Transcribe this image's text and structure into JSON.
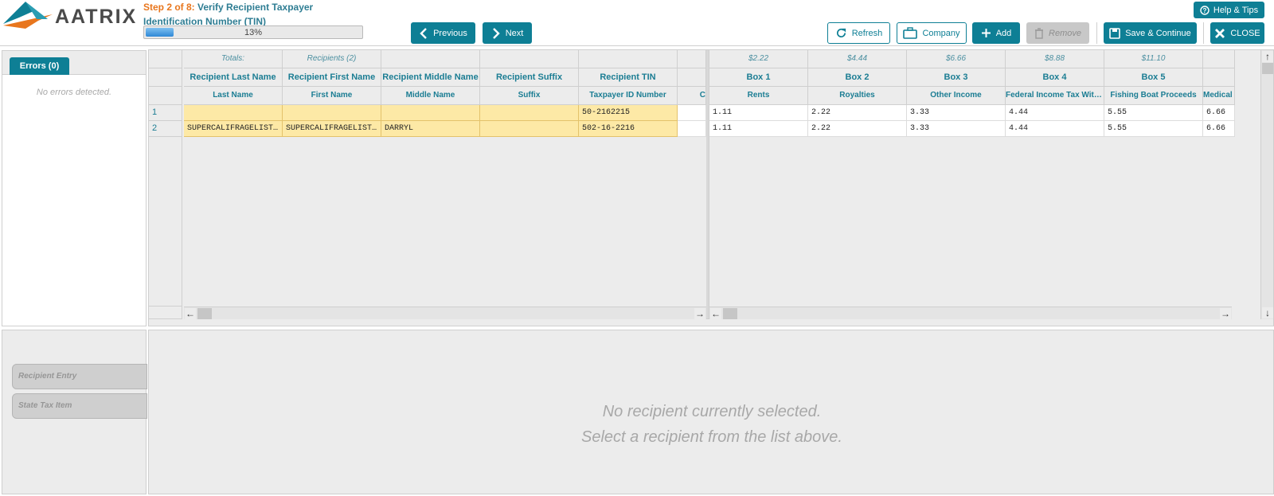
{
  "brand": {
    "name": "AATRIX"
  },
  "step": {
    "prefix": "Step 2 of 8:",
    "title": "Verify Recipient Taxpayer Identification Number (TIN)"
  },
  "progress": {
    "percent": 13,
    "label": "13%"
  },
  "nav": {
    "previous": "Previous",
    "next": "Next"
  },
  "toolbar": {
    "refresh": "Refresh",
    "company": "Company",
    "add": "Add",
    "remove": "Remove",
    "save": "Save & Continue",
    "close": "CLOSE"
  },
  "help": "Help & Tips",
  "errors": {
    "tab": "Errors (0)",
    "empty": "No errors detected."
  },
  "left_grid": {
    "totals": [
      "Totals:",
      "Recipients (2)",
      "",
      "",
      ""
    ],
    "headers": [
      "Recipient Last Name",
      "Recipient First Name",
      "Recipient Middle Name",
      "Recipient Suffix",
      "Recipient TIN"
    ],
    "subheaders": [
      "Last Name",
      "First Name",
      "Middle Name",
      "Suffix",
      "Taxpayer ID Number"
    ],
    "extra_sub": "C",
    "rows": [
      {
        "n": "1",
        "cells": [
          "",
          "",
          "",
          "",
          "50-2162215"
        ]
      },
      {
        "n": "2",
        "cells": [
          "SUPERCALIFRAGELISTICEXPIALIDOCIOUS",
          "SUPERCALIFRAGELISTICEXPIALIDOCIOUS",
          "DARRYL",
          "",
          "502-16-2216"
        ]
      }
    ]
  },
  "right_grid": {
    "totals": [
      "$2.22",
      "$4.44",
      "$6.66",
      "$8.88",
      "$11.10",
      ""
    ],
    "headers": [
      "Box 1",
      "Box 2",
      "Box 3",
      "Box 4",
      "Box 5",
      ""
    ],
    "subheaders": [
      "Rents",
      "Royalties",
      "Other Income",
      "Federal Income Tax Withheld",
      "Fishing Boat Proceeds",
      "Medical"
    ],
    "rows": [
      [
        "1.11",
        "2.22",
        "3.33",
        "4.44",
        "5.55",
        "6.66"
      ],
      [
        "1.11",
        "2.22",
        "3.33",
        "4.44",
        "5.55",
        "6.66"
      ]
    ]
  },
  "side_tabs": [
    "Recipient Entry",
    "State Tax Item"
  ],
  "detail": {
    "line1": "No recipient currently selected.",
    "line2": "Select a recipient from the list above."
  }
}
